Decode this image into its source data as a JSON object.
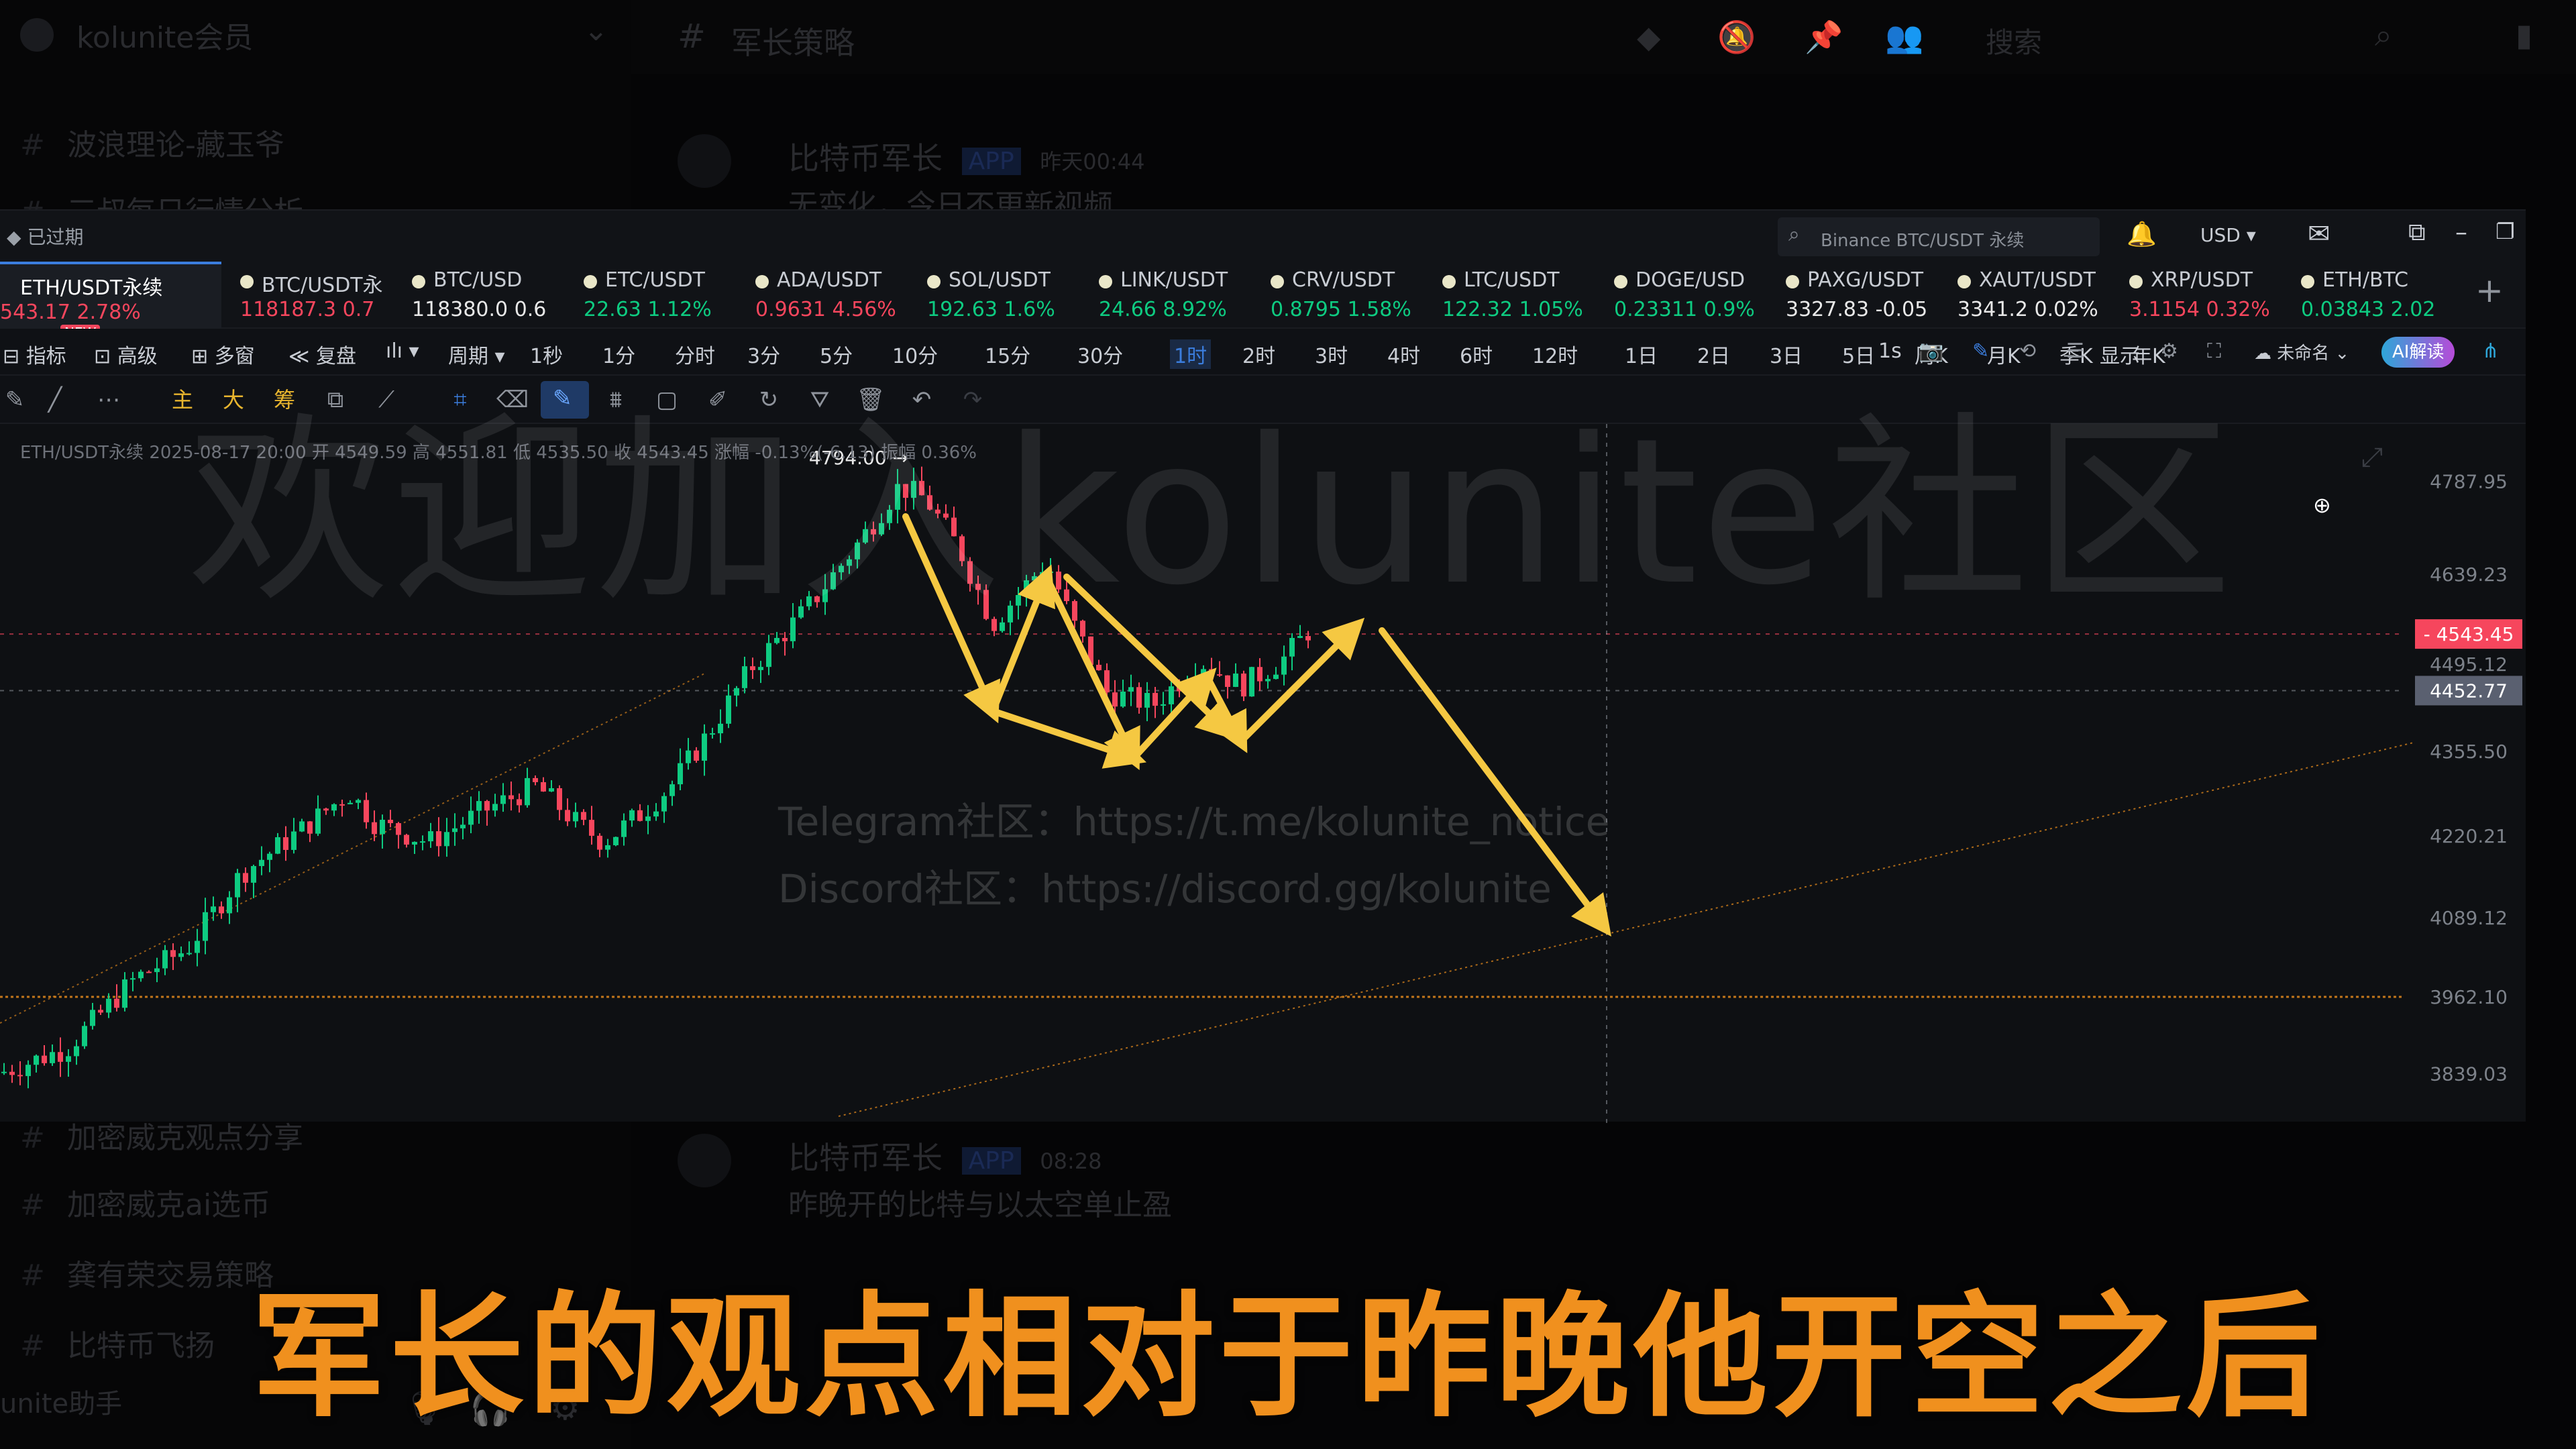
{
  "app": {
    "server_name": "kolunite会员",
    "channel_title": "军长策略",
    "search_placeholder": "搜索"
  },
  "sidebar": {
    "items": [
      {
        "label": "波浪理论-藏玉爷"
      },
      {
        "label": "三叔每日行情分析"
      },
      {
        "label": "加密威克观点分享"
      },
      {
        "label": "加密威克ai选币"
      },
      {
        "label": "龚有荣交易策略"
      },
      {
        "label": "比特币飞扬"
      }
    ],
    "bottom_user": "unite助手"
  },
  "messages": [
    {
      "author": "比特币军长",
      "badge": "APP",
      "time": "昨天00:44",
      "text": "无变化，今日不更新视频"
    },
    {
      "author": "比特币军长",
      "badge": "APP",
      "time": "08:28",
      "text": "昨晚开的比特与以太空单止盈"
    }
  ],
  "chart_window": {
    "status_badge": "已过期",
    "search_text": "Binance BTC/USDT 永续",
    "currency": "USD",
    "tickers": [
      {
        "symbol": "ETH/USDT永续",
        "value": "543.17 2.78%",
        "color": "#f6465d",
        "active": true,
        "badge": "NEW"
      },
      {
        "symbol": "BTC/USDT永",
        "value": "118187.3 0.7",
        "color": "#f6465d"
      },
      {
        "symbol": "BTC/USD",
        "value": "118380.0 0.6",
        "color": "#e8e8e8"
      },
      {
        "symbol": "ETC/USDT",
        "value": "22.63 1.12%",
        "color": "#0ecb81"
      },
      {
        "symbol": "ADA/USDT",
        "value": "0.9631 4.56%",
        "color": "#f6465d"
      },
      {
        "symbol": "SOL/USDT",
        "value": "192.63 1.6%",
        "color": "#0ecb81"
      },
      {
        "symbol": "LINK/USDT",
        "value": "24.66 8.92%",
        "color": "#0ecb81"
      },
      {
        "symbol": "CRV/USDT",
        "value": "0.8795 1.58%",
        "color": "#0ecb81"
      },
      {
        "symbol": "LTC/USDT",
        "value": "122.32 1.05%",
        "color": "#0ecb81"
      },
      {
        "symbol": "DOGE/USD",
        "value": "0.23311 0.9%",
        "color": "#0ecb81"
      },
      {
        "symbol": "PAXG/USDT",
        "value": "3327.83 -0.05",
        "color": "#e8e8e8"
      },
      {
        "symbol": "XAUT/USDT",
        "value": "3341.2 0.02%",
        "color": "#e8e8e8"
      },
      {
        "symbol": "XRP/USDT",
        "value": "3.1154 0.32%",
        "color": "#f6465d"
      },
      {
        "symbol": "ETH/BTC",
        "value": "0.03843 2.02",
        "color": "#0ecb81"
      }
    ],
    "toolbar_left": [
      "指标",
      "高级",
      "多窗",
      "复盘",
      "周期"
    ],
    "timeframes": [
      "1秒",
      "1分",
      "分时",
      "3分",
      "5分",
      "10分",
      "15分",
      "30分",
      "1时",
      "2时",
      "3时",
      "4时",
      "6时",
      "12时",
      "1日",
      "2日",
      "3日",
      "5日",
      "周K",
      "月K",
      "季K",
      "年K"
    ],
    "active_timeframe": "1时",
    "toolbar_right": [
      "1s",
      "显示",
      "未命名",
      "AI解读"
    ],
    "draw_tools": [
      "主",
      "大",
      "筹"
    ],
    "ohlc_text": "ETH/USDT永续  2025-08-17 20:00  开 4549.59  高 4551.81  低 4535.50  收 4543.45  涨幅 -0.13%(-6.13)  振幅 0.36%",
    "peak_label": "4794.00",
    "price_axis": [
      "4787.95",
      "4639.23",
      "4495.12",
      "4355.50",
      "4220.21",
      "4089.12",
      "3962.10",
      "3839.03"
    ],
    "current_price_tag": "4543.45",
    "crosshair_price_tag": "4452.77",
    "watermark": "欢迎加入kolunite社区",
    "telegram_line": "Telegram社区：https://t.me/kolunite_notice",
    "discord_line": "Discord社区：https://discord.gg/kolunite"
  },
  "subtitle": "军长的观点相对于昨晚他开空之后",
  "colors": {
    "up": "#0ecb81",
    "down": "#f6465d",
    "arrow": "#f5c842",
    "subtitle": "#f0901e",
    "accent_blue": "#3b7ddd"
  }
}
